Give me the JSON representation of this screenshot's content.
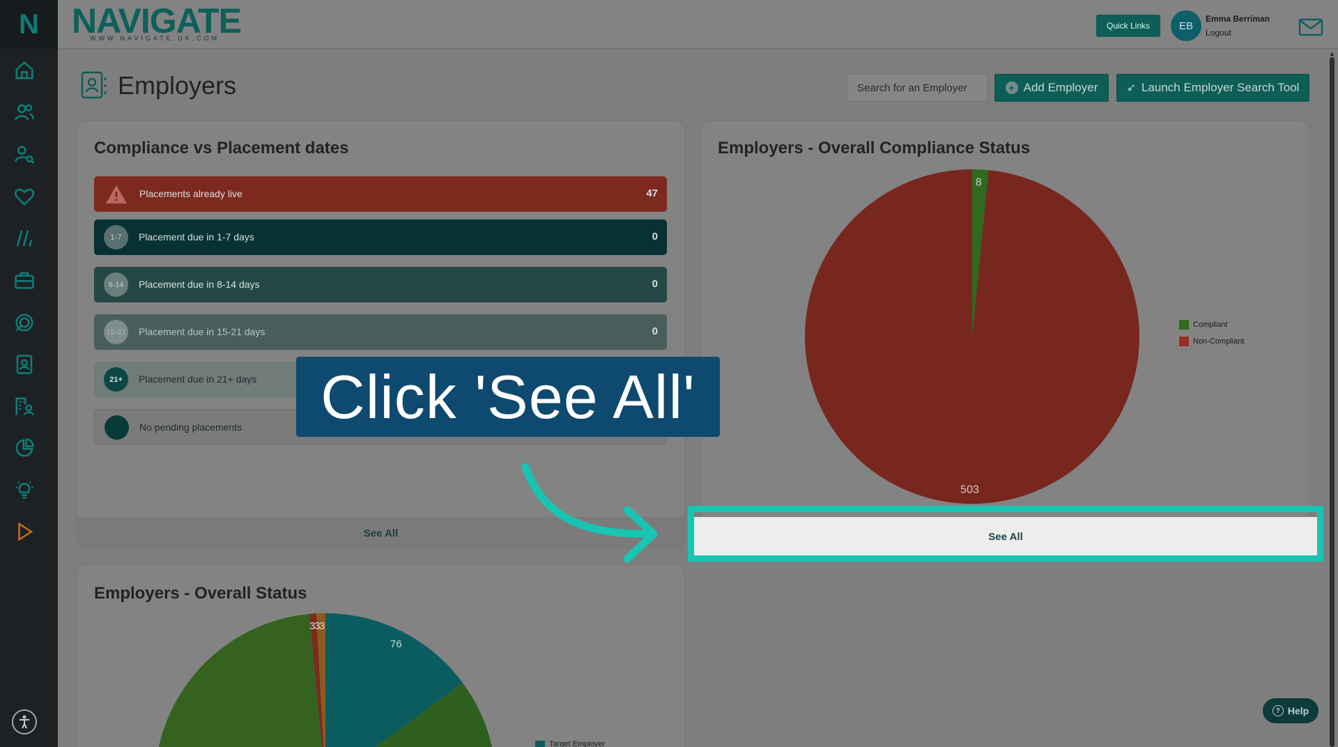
{
  "brand": {
    "logo_letter": "N",
    "wordmark": "NAVIGATE",
    "url": "WWW.NAVIGATE.UK.COM"
  },
  "header": {
    "quick_links": "Quick Links",
    "avatar_initials": "EB",
    "user_name": "Emma Berriman",
    "logout": "Logout"
  },
  "sidebar": {
    "items": [
      "home-icon",
      "users-icon",
      "user-search-icon",
      "heart-icon",
      "slashes-icon",
      "briefcase-icon",
      "rocket-icon",
      "contact-card-icon",
      "building-user-icon",
      "pie-chart-icon",
      "lightbulb-icon",
      "play-icon"
    ]
  },
  "page": {
    "title": "Employers",
    "search_placeholder": "Search for an Employer",
    "add_employer": "Add Employer",
    "launch_tool": "Launch Employer Search Tool"
  },
  "compliance_card": {
    "title": "Compliance vs Placement dates",
    "rows": [
      {
        "label": "Placements already live",
        "badge": "!",
        "count": "47",
        "color": "#7d291e"
      },
      {
        "label": "Placement due in 1-7 days",
        "badge": "1-7",
        "count": "0",
        "color": "#073133"
      },
      {
        "label": "Placement due in 8-14 days",
        "badge": "8-14",
        "count": "0",
        "color": "#244845"
      },
      {
        "label": "Placement due in 15-21 days",
        "badge": "15-21",
        "count": "0",
        "color": "#475e5b"
      },
      {
        "label": "Placement due in 21+ days",
        "badge": "21+",
        "count": "",
        "color": "#6f7c7a"
      },
      {
        "label": "No pending placements",
        "badge": "",
        "count": "",
        "color": "#7b7b7b"
      }
    ],
    "see_all": "See All"
  },
  "overall_compliance_card": {
    "title": "Employers - Overall Compliance Status",
    "see_all": "See All"
  },
  "overall_status_card": {
    "title": "Employers - Overall Status",
    "legend_partial": "Target Employer"
  },
  "chart_data": [
    {
      "type": "pie",
      "title": "Employers - Overall Compliance Status",
      "categories": [
        "Compliant",
        "Non-Compliant"
      ],
      "values": [
        8,
        503
      ],
      "colors": [
        "#2f6a1e",
        "#78271e"
      ],
      "legend": "right"
    },
    {
      "type": "pie",
      "title": "Employers - Overall Status",
      "visible_labels": [
        "3",
        "3",
        "3",
        "76"
      ],
      "partial": true,
      "colors": [
        "#0b5c5e",
        "#2f6a1e",
        "#78271e",
        "#9a6a1e"
      ],
      "legend_entries_visible": [
        "Target Employer"
      ]
    }
  ],
  "overlay": {
    "callout": "Click 'See All'"
  },
  "help": {
    "label": "Help"
  },
  "colors": {
    "teal": "#0d5e57",
    "highlight": "#18c5b4",
    "callout": "#0e4a6f"
  }
}
